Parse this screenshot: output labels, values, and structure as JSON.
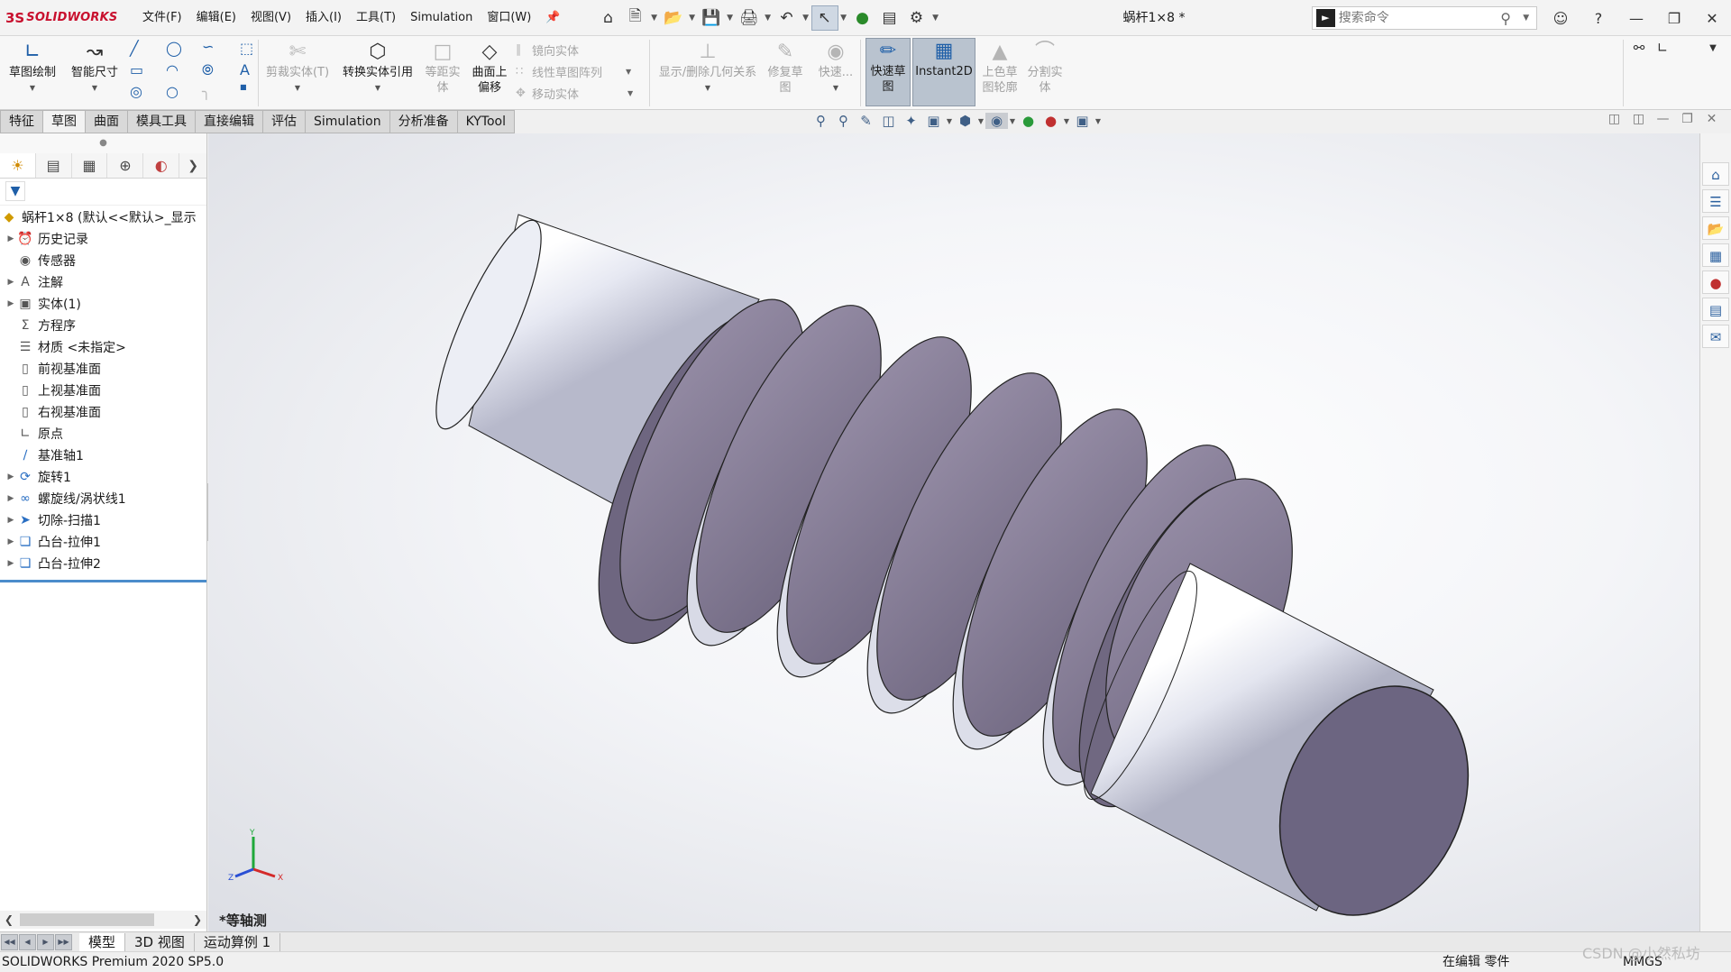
{
  "app": {
    "logo_mark": "3S",
    "logo_text": "SOLIDWORKS",
    "brand_color": "#c8102e"
  },
  "menu": [
    "文件(F)",
    "编辑(E)",
    "视图(V)",
    "插入(I)",
    "工具(T)",
    "Simulation",
    "窗口(W)"
  ],
  "document_title": "蜗杆1×8 *",
  "search": {
    "placeholder": "搜索命令"
  },
  "command_manager": {
    "sketch": "草图绘制",
    "smart_dim": "智能尺寸",
    "trim": "剪裁实体(T)",
    "convert": "转换实体引用",
    "offset_entity_1": "等距实",
    "offset_entity_2": "体",
    "offset_surface_1": "曲面上",
    "offset_surface_2": "偏移",
    "mirror": "镜向实体",
    "linear_pattern": "线性草图阵列",
    "move": "移动实体",
    "relations": "显示/删除几何关系",
    "repair_1": "修复草",
    "repair_2": "图",
    "quick_snaps": "快速...",
    "rapid_sketch_1": "快速草",
    "rapid_sketch_2": "图",
    "instant2d": "Instant2D",
    "shaded_1": "上色草",
    "shaded_2": "图轮廓",
    "split_1": "分割实",
    "split_2": "体"
  },
  "tabs": [
    {
      "label": "特征",
      "active": false
    },
    {
      "label": "草图",
      "active": true
    },
    {
      "label": "曲面",
      "active": false
    },
    {
      "label": "模具工具",
      "active": false
    },
    {
      "label": "直接编辑",
      "active": false
    },
    {
      "label": "评估",
      "active": false
    },
    {
      "label": "Simulation",
      "active": false
    },
    {
      "label": "分析准备",
      "active": false
    },
    {
      "label": "KYTool",
      "active": false
    }
  ],
  "feature_tree": {
    "root": "蜗杆1×8  (默认<<默认>_显示",
    "items": [
      {
        "label": "历史记录",
        "icon": "history-icon",
        "expandable": true
      },
      {
        "label": "传感器",
        "icon": "sensor-icon",
        "expandable": false
      },
      {
        "label": "注解",
        "icon": "annotation-icon",
        "expandable": true
      },
      {
        "label": "实体(1)",
        "icon": "solid-bodies-icon",
        "expandable": true
      },
      {
        "label": "方程序",
        "icon": "equation-icon",
        "expandable": false
      },
      {
        "label": "材质 <未指定>",
        "icon": "material-icon",
        "expandable": false
      },
      {
        "label": "前视基准面",
        "icon": "plane-icon",
        "expandable": false
      },
      {
        "label": "上视基准面",
        "icon": "plane-icon",
        "expandable": false
      },
      {
        "label": "右视基准面",
        "icon": "plane-icon",
        "expandable": false
      },
      {
        "label": "原点",
        "icon": "origin-icon",
        "expandable": false
      },
      {
        "label": "基准轴1",
        "icon": "axis-icon",
        "expandable": false
      },
      {
        "label": "旋转1",
        "icon": "revolve-icon",
        "expandable": true
      },
      {
        "label": "螺旋线/涡状线1",
        "icon": "helix-icon",
        "expandable": true
      },
      {
        "label": "切除-扫描1",
        "icon": "cut-sweep-icon",
        "expandable": true
      },
      {
        "label": "凸台-拉伸1",
        "icon": "boss-extrude-icon",
        "expandable": true
      },
      {
        "label": "凸台-拉伸2",
        "icon": "boss-extrude-icon",
        "expandable": true
      }
    ]
  },
  "viewport": {
    "view_name": "*等轴测",
    "triad": {
      "x": "X",
      "y": "Y",
      "z": "Z"
    }
  },
  "bottom_tabs": [
    "模型",
    "3D 视图",
    "运动算例 1"
  ],
  "status": {
    "left": "SOLIDWORKS Premium 2020 SP5.0",
    "editing": "在编辑 零件",
    "units": "MMGS",
    "watermark": "CSDN @小然私坊"
  },
  "colors": {
    "model_face": "#8a8199",
    "model_shaft": "#d9dbe8",
    "active_tab": "#f2f2f2"
  }
}
